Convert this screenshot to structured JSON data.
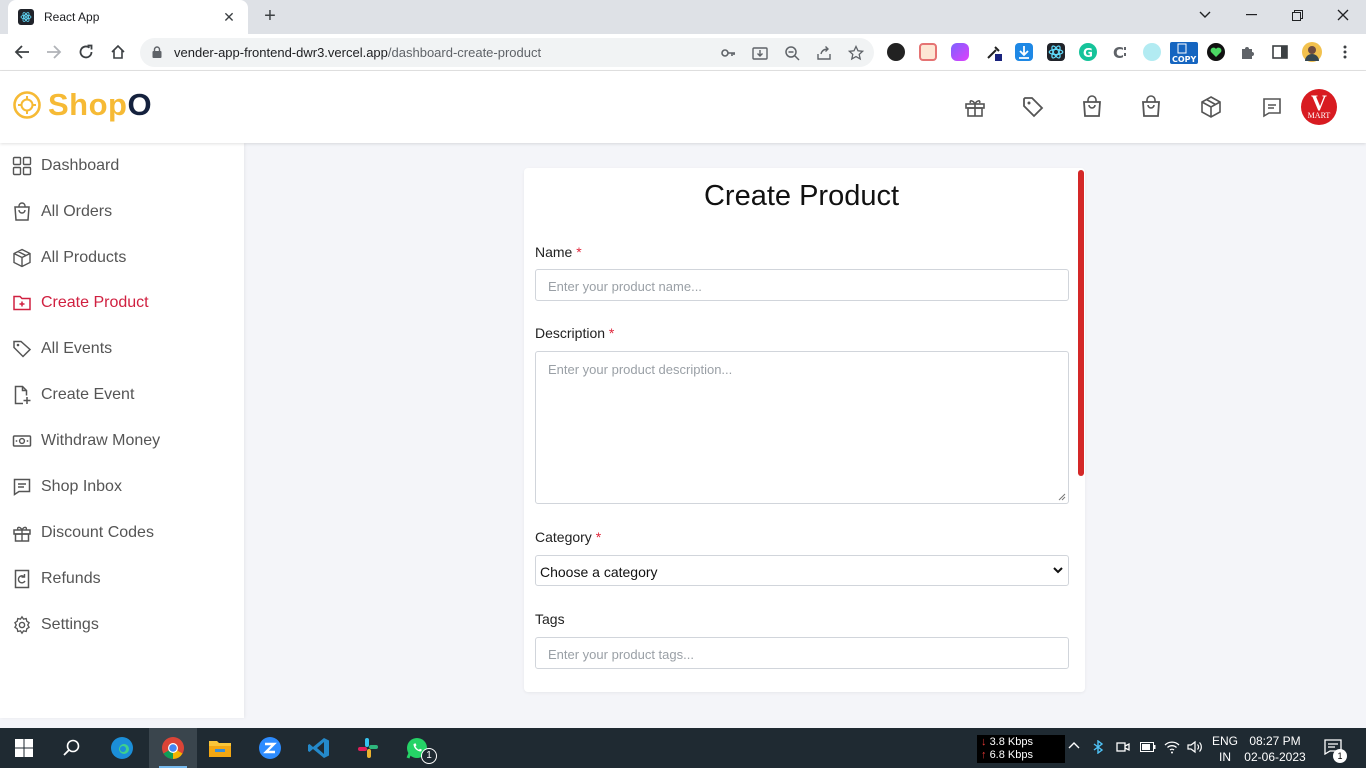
{
  "browser": {
    "tab_title": "React App",
    "tab_close": "✕",
    "new_tab": "+",
    "url_host": "vender-app-frontend-dwr3.vercel.app",
    "url_path": "/dashboard-create-product"
  },
  "app": {
    "logo_main": "Shop",
    "logo_accent": "O",
    "avatar_letter": "V",
    "avatar_sub": "MART"
  },
  "sidebar": {
    "items": [
      {
        "label": "Dashboard",
        "icon": "dashboard-grid-icon"
      },
      {
        "label": "All Orders",
        "icon": "shopping-bag-icon"
      },
      {
        "label": "All Products",
        "icon": "package-icon"
      },
      {
        "label": "Create Product",
        "icon": "folder-plus-icon",
        "active": true
      },
      {
        "label": "All Events",
        "icon": "tag-icon"
      },
      {
        "label": "Create Event",
        "icon": "file-plus-icon"
      },
      {
        "label": "Withdraw Money",
        "icon": "money-icon"
      },
      {
        "label": "Shop Inbox",
        "icon": "message-icon"
      },
      {
        "label": "Discount Codes",
        "icon": "gift-icon"
      },
      {
        "label": "Refunds",
        "icon": "refund-icon"
      },
      {
        "label": "Settings",
        "icon": "gear-icon"
      }
    ]
  },
  "form": {
    "title": "Create Product",
    "required_mark": "*",
    "name_label": "Name",
    "name_placeholder": "Enter your product name...",
    "description_label": "Description",
    "description_placeholder": "Enter your product description...",
    "category_label": "Category",
    "category_selected": "Choose a category",
    "tags_label": "Tags",
    "tags_placeholder": "Enter your product tags..."
  },
  "taskbar": {
    "net_down": "3.8 Kbps",
    "net_up": "6.8 Kbps",
    "lang": "ENG",
    "region": "IN",
    "time": "08:27 PM",
    "date": "02-06-2023",
    "notif_count": "1",
    "whatsapp_badge": "1"
  },
  "colors": {
    "accent": "#d02040",
    "logo_yellow": "#f6ba35",
    "logo_navy": "#14213d",
    "scrollbar": "#d42828"
  }
}
